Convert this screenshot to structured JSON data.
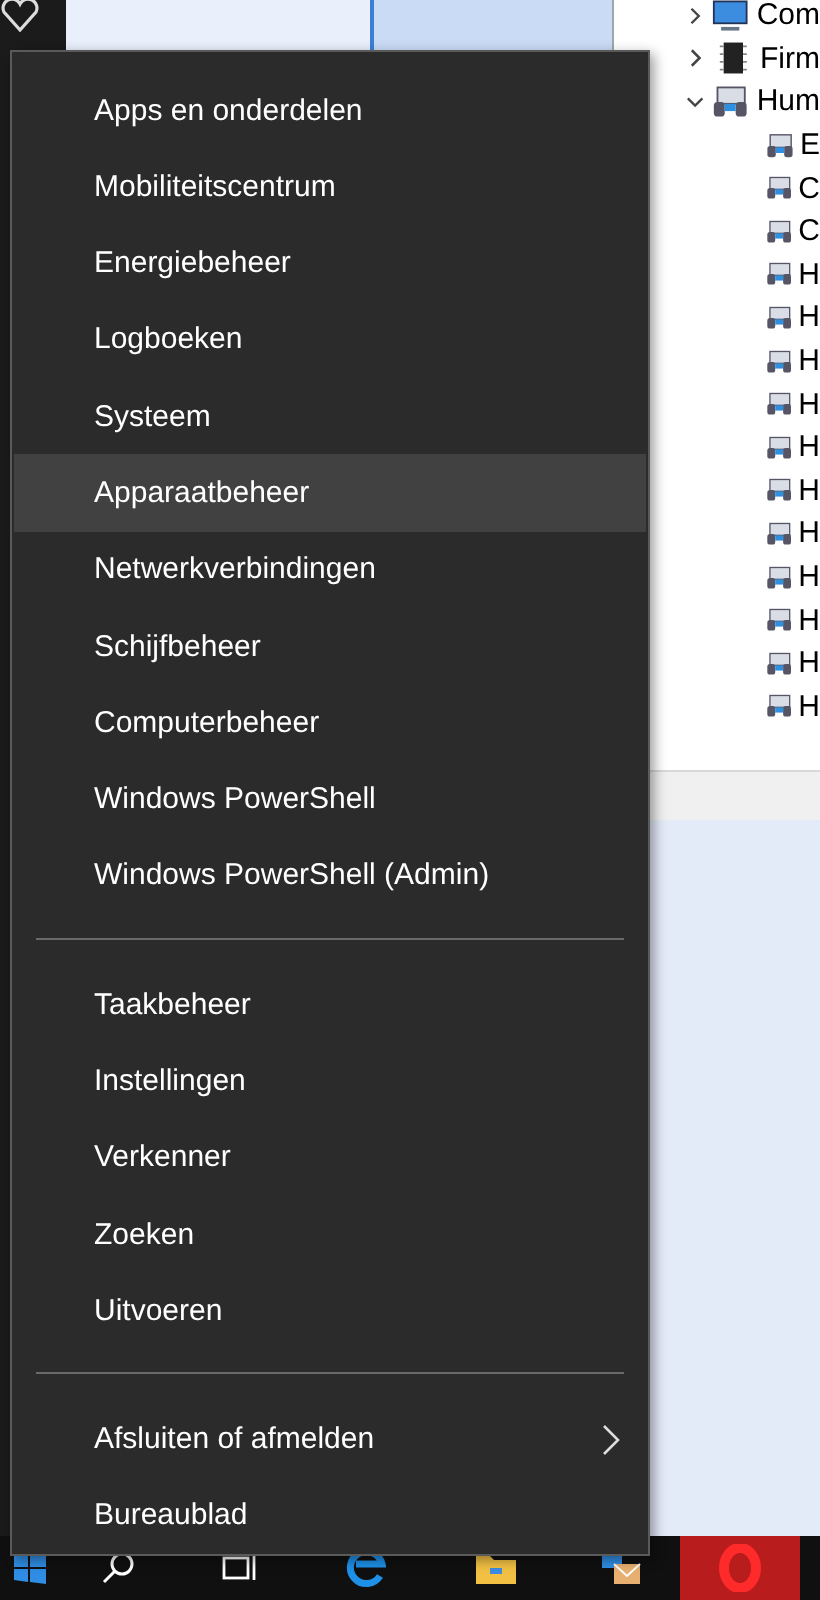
{
  "context_menu": {
    "groups": [
      {
        "items": [
          {
            "label": "Apps en onderdelen",
            "selected": false,
            "submenu": false
          },
          {
            "label": "Mobiliteitscentrum",
            "selected": false,
            "submenu": false
          },
          {
            "label": "Energiebeheer",
            "selected": false,
            "submenu": false
          },
          {
            "label": "Logboeken",
            "selected": false,
            "submenu": false
          },
          {
            "label": "Systeem",
            "selected": false,
            "submenu": false
          },
          {
            "label": "Apparaatbeheer",
            "selected": true,
            "submenu": false
          },
          {
            "label": "Netwerkverbindingen",
            "selected": false,
            "submenu": false
          },
          {
            "label": "Schijfbeheer",
            "selected": false,
            "submenu": false
          },
          {
            "label": "Computerbeheer",
            "selected": false,
            "submenu": false
          },
          {
            "label": "Windows PowerShell",
            "selected": false,
            "submenu": false
          },
          {
            "label": "Windows PowerShell (Admin)",
            "selected": false,
            "submenu": false
          }
        ]
      },
      {
        "items": [
          {
            "label": "Taakbeheer",
            "selected": false,
            "submenu": false
          },
          {
            "label": "Instellingen",
            "selected": false,
            "submenu": false
          },
          {
            "label": "Verkenner",
            "selected": false,
            "submenu": false
          },
          {
            "label": "Zoeken",
            "selected": false,
            "submenu": false
          },
          {
            "label": "Uitvoeren",
            "selected": false,
            "submenu": false
          }
        ]
      },
      {
        "items": [
          {
            "label": "Afsluiten of afmelden",
            "selected": false,
            "submenu": true
          },
          {
            "label": "Bureaublad",
            "selected": false,
            "submenu": false
          }
        ]
      }
    ]
  },
  "device_tree": {
    "items": [
      {
        "label": "Com",
        "kind": "monitor",
        "expanded": false
      },
      {
        "label": "Firm",
        "kind": "chip",
        "expanded": false
      },
      {
        "label": "Hum",
        "kind": "hid",
        "expanded": true,
        "children": [
          {
            "label": "E"
          },
          {
            "label": "C"
          },
          {
            "label": "C"
          },
          {
            "label": "H"
          },
          {
            "label": "H"
          },
          {
            "label": "H"
          },
          {
            "label": "H"
          },
          {
            "label": "H"
          },
          {
            "label": "H"
          },
          {
            "label": "H"
          },
          {
            "label": "H"
          },
          {
            "label": "H"
          },
          {
            "label": "H"
          },
          {
            "label": "H"
          }
        ]
      }
    ]
  }
}
